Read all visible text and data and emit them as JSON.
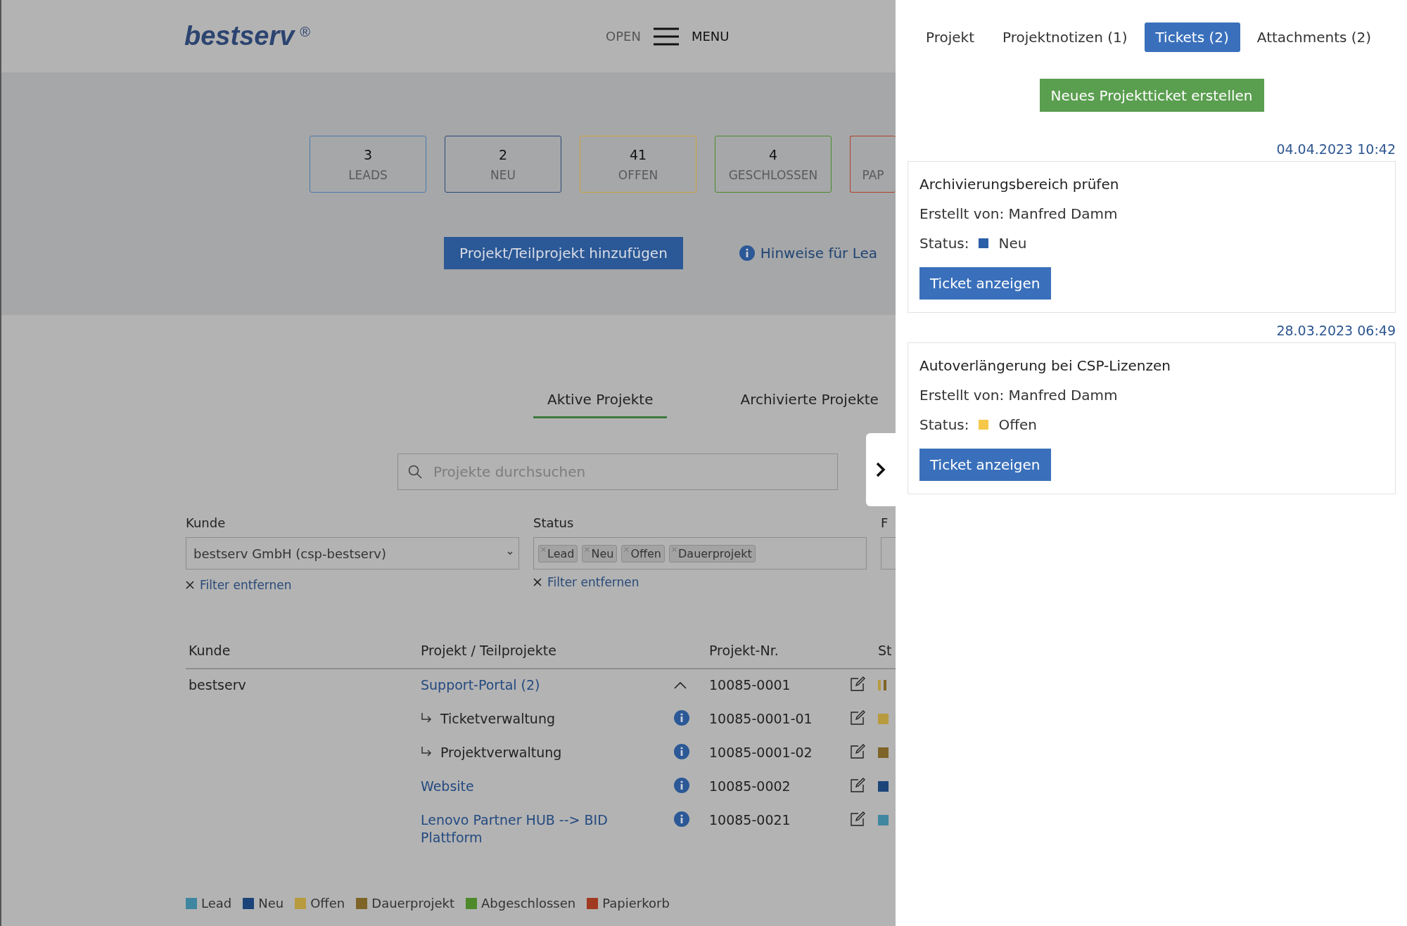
{
  "header": {
    "logo": "bestserv",
    "logo_mark": "®",
    "open_label": "OPEN",
    "menu_label": "MENU"
  },
  "stats": [
    {
      "count": "3",
      "label": "LEADS",
      "color": "#4a79a8"
    },
    {
      "count": "2",
      "label": "NEU",
      "color": "#2a4a78"
    },
    {
      "count": "41",
      "label": "OFFEN",
      "color": "#c9a33a"
    },
    {
      "count": "4",
      "label": "GESCHLOSSEN",
      "color": "#4a8a2a"
    },
    {
      "label": "PAP",
      "color": "#b0402a"
    }
  ],
  "add_button": "Projekt/Teilprojekt hinzufügen",
  "hints_link": "Hinweise für Lea",
  "view_tabs": [
    {
      "label": "Aktive Projekte",
      "selected": true
    },
    {
      "label": "Archivierte Projekte",
      "selected": false
    }
  ],
  "search": {
    "placeholder": "Projekte durchsuchen"
  },
  "filters": [
    {
      "kind": "select",
      "label": "Kunde",
      "value": "bestserv GmbH (csp-bestserv)",
      "remove": "Filter entfernen"
    },
    {
      "kind": "tags",
      "label": "Status",
      "tags": [
        "Lead",
        "Neu",
        "Offen",
        "Dauerprojekt"
      ],
      "remove": "Filter entfernen"
    },
    {
      "kind": "partial",
      "label": "F"
    }
  ],
  "table": {
    "columns": [
      "Kunde",
      "Projekt / Teilprojekte",
      "Projekt-Nr.",
      "St"
    ],
    "rows": [
      {
        "kind": "group",
        "customer": "bestserv",
        "project": "Support-Portal (2)",
        "expanded": true,
        "number": "10085-0001",
        "status_marks": [
          {
            "color": "#b89a3f"
          },
          {
            "color": "#7f6428"
          }
        ]
      },
      {
        "kind": "sub",
        "project": "Ticketverwaltung",
        "number": "10085-0001-01",
        "status_marks": [
          {
            "color": "#b89a3f"
          }
        ]
      },
      {
        "kind": "sub",
        "project": "Projektverwaltung",
        "number": "10085-0001-02",
        "status_marks": [
          {
            "color": "#7f6428"
          }
        ]
      },
      {
        "kind": "item",
        "project": "Website",
        "number": "10085-0002",
        "status_marks": [
          {
            "color": "#1d4479"
          }
        ]
      },
      {
        "kind": "item",
        "project": "Lenovo Partner HUB --> BID Plattform",
        "number": "10085-0021",
        "status_marks": [
          {
            "color": "#3f86a0"
          }
        ]
      }
    ]
  },
  "legend": [
    {
      "label": "Lead",
      "color": "#3f86a0"
    },
    {
      "label": "Neu",
      "color": "#1d4479"
    },
    {
      "label": "Offen",
      "color": "#b89a3f"
    },
    {
      "label": "Dauerprojekt",
      "color": "#7f6428"
    },
    {
      "label": "Abgeschlossen",
      "color": "#4e8a2a"
    },
    {
      "label": "Papierkorb",
      "color": "#a03a20"
    }
  ],
  "panel": {
    "tabs": [
      {
        "label": "Projekt",
        "selected": false
      },
      {
        "label": "Projektnotizen (1)",
        "selected": false
      },
      {
        "label": "Tickets (2)",
        "selected": true
      },
      {
        "label": "Attachments (2)",
        "selected": false
      }
    ],
    "new_ticket_button": "Neues Projektticket erstellen",
    "tickets": [
      {
        "date": "04.04.2023 10:42",
        "title": "Archivierungsbereich prüfen",
        "author": "Erstellt von: Manfred Damm",
        "status_label": "Status:",
        "status": "Neu",
        "color": "#2a5fa8",
        "button": "Ticket anzeigen"
      },
      {
        "date": "28.03.2023 06:49",
        "title": "Autoverlängerung bei CSP-Lizenzen",
        "author": "Erstellt von: Manfred Damm",
        "status_label": "Status:",
        "status": "Offen",
        "color": "#f5c84a",
        "button": "Ticket anzeigen"
      }
    ]
  }
}
